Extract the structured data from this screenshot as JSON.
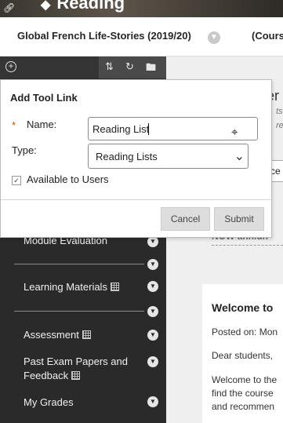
{
  "banner": {
    "title": "Reading",
    "link_icon": "link-icon",
    "title_icon": "diamond-icon"
  },
  "course": {
    "title": "Global French Life-Stories (2019/20)",
    "right_fragment": "(Cours",
    "chevron_icon": "chevron-down-icon"
  },
  "toolbar": {
    "add_icon": "plus-circle-icon",
    "sort_icon": "sort-icon",
    "refresh_icon": "refresh-icon",
    "folder_icon": "folder-icon"
  },
  "menu": {
    "items": [
      {
        "label": "Module Evaluation"
      },
      {
        "label": "Learning Materials"
      },
      {
        "label": "Assessment"
      },
      {
        "label": "Past Exam Papers and"
      },
      {
        "label": "Feedback"
      },
      {
        "label": "My Grades"
      }
    ]
  },
  "content": {
    "partial_heading": "er",
    "partial_info1": "ts",
    "partial_info2": "res",
    "tab_fragment": "ce",
    "news_fragment": "NOW ahn.un",
    "card": {
      "welcome": "Welcome to",
      "posted": "Posted on: Mon",
      "dear": "Dear students,",
      "body_lines": [
        "Welcome to the",
        "find the course",
        "and recommen"
      ]
    }
  },
  "dialog": {
    "title": "Add Tool Link",
    "required_mark": "*",
    "name_label": "Name:",
    "name_value": "Reading List",
    "type_label": "Type:",
    "type_value": "Reading Lists",
    "available_label": "Available to Users",
    "available_checked": true,
    "cancel_label": "Cancel",
    "submit_label": "Submit"
  },
  "colors": {
    "menu_bg": "#2a2a2a",
    "required": "#cc5500",
    "button_bg": "#dddddd"
  }
}
